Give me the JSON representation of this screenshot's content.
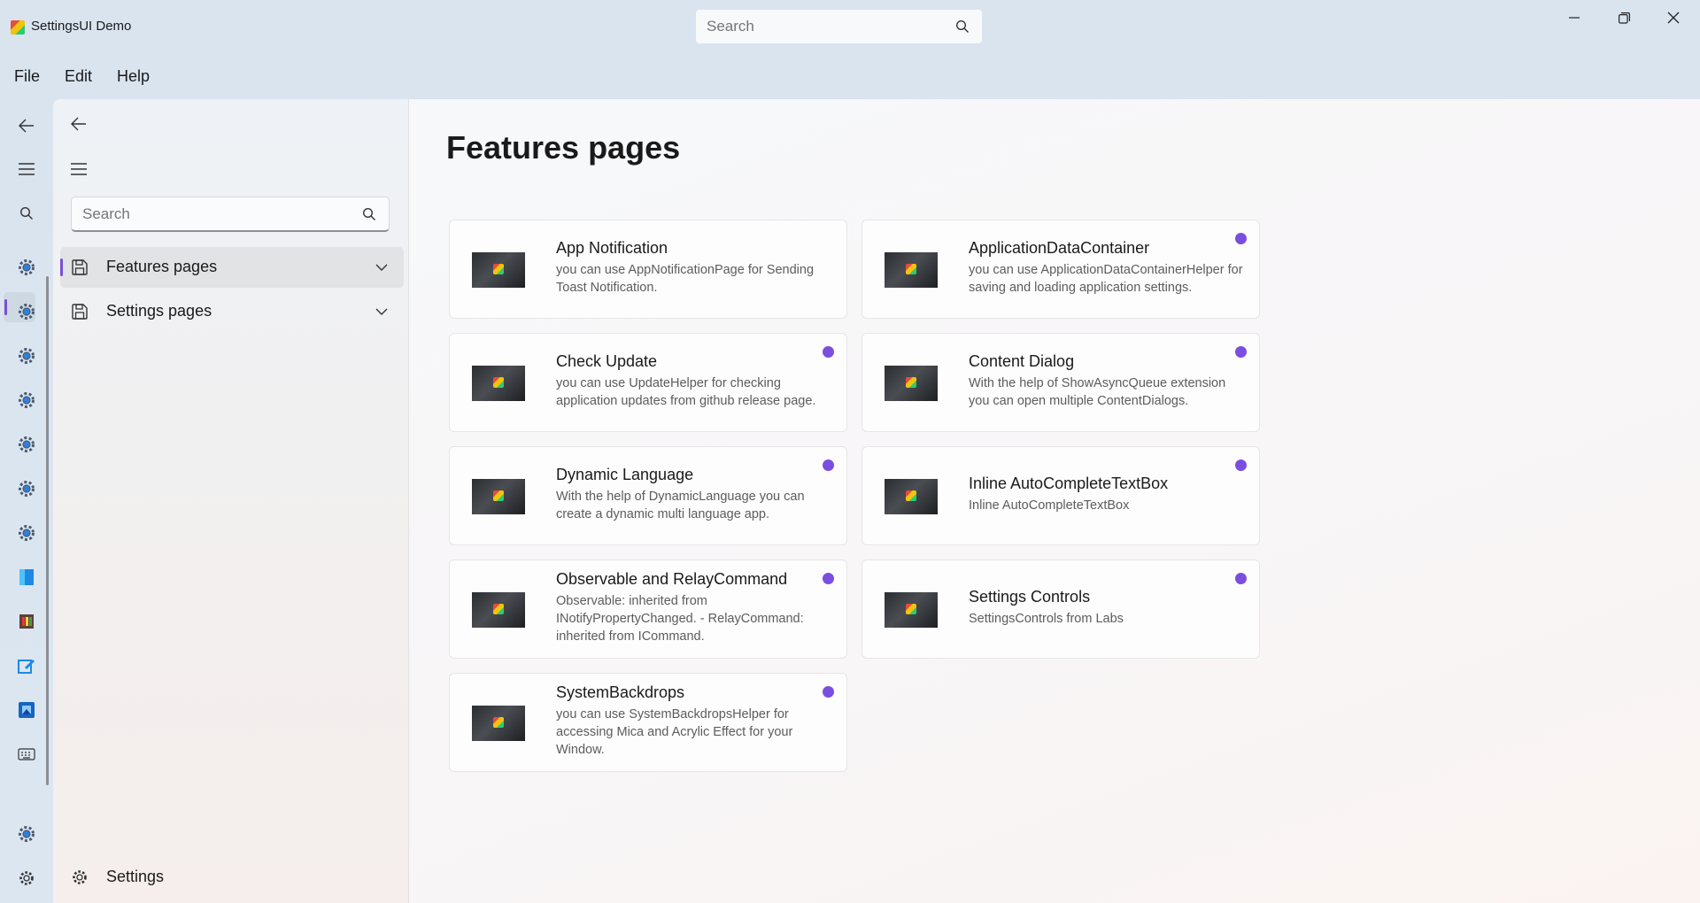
{
  "app": {
    "title": "SettingsUI Demo"
  },
  "titlebar": {
    "search_placeholder": "Search"
  },
  "menu": [
    "File",
    "Edit",
    "Help"
  ],
  "rail": {
    "icons": [
      "back-icon",
      "hamburger-icon",
      "search-icon",
      "gear-icon",
      "gear-icon",
      "gear-icon",
      "gear-icon",
      "gear-icon",
      "gear-icon",
      "gear-icon",
      "windows-icon",
      "gallery-icon",
      "edit-icon",
      "photos-icon",
      "keyboard-icon"
    ],
    "bottom_icons": [
      "gear-icon",
      "settings-icon"
    ]
  },
  "nav": {
    "search_placeholder": "Search",
    "items": [
      {
        "label": "Features pages",
        "selected": true
      },
      {
        "label": "Settings pages",
        "selected": false
      }
    ],
    "footer_label": "Settings"
  },
  "page": {
    "title": "Features pages",
    "accent": "#7b4ee0",
    "cards": [
      {
        "title": "App Notification",
        "desc": "you can use AppNotificationPage for Sending Toast Notification.",
        "badge": false
      },
      {
        "title": "ApplicationDataContainer",
        "desc": "you can use ApplicationDataContainerHelper for saving and loading application settings.",
        "badge": true
      },
      {
        "title": "Check Update",
        "desc": "you can use UpdateHelper for checking application updates from github release page.",
        "badge": true
      },
      {
        "title": "Content Dialog",
        "desc": "With the help of ShowAsyncQueue extension you can open multiple ContentDialogs.",
        "badge": true
      },
      {
        "title": "Dynamic Language",
        "desc": "With the help of DynamicLanguage you can create a dynamic multi language app.",
        "badge": true
      },
      {
        "title": "Inline AutoCompleteTextBox",
        "desc": "Inline AutoCompleteTextBox",
        "badge": true
      },
      {
        "title": "Observable and RelayCommand",
        "desc": "Observable: inherited from INotifyPropertyChanged. - RelayCommand: inherited from ICommand.",
        "badge": true
      },
      {
        "title": "Settings Controls",
        "desc": "SettingsControls from Labs",
        "badge": true
      },
      {
        "title": "SystemBackdrops",
        "desc": "you can use SystemBackdropsHelper for accessing Mica and Acrylic Effect for your Window.",
        "badge": true
      }
    ]
  }
}
